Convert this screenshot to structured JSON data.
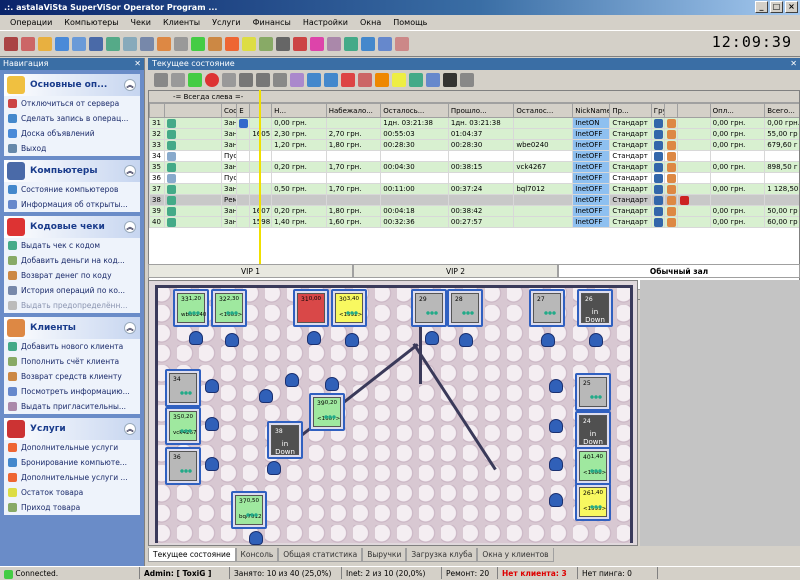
{
  "window": {
    "title": ".:. astalaViSta SuperViSor Operator Program ..."
  },
  "menu": [
    "Операции",
    "Компьютеры",
    "Чеки",
    "Клиенты",
    "Услуги",
    "Финансы",
    "Настройки",
    "Окна",
    "Помощь"
  ],
  "clock": "12:09:39",
  "nav": {
    "title": "Навигация",
    "sections": [
      {
        "title": "Основные оп...",
        "items": [
          "Отключиться от сервера",
          "Сделать запись в операц...",
          "Доска объявлений",
          "Выход"
        ]
      },
      {
        "title": "Компьютеры",
        "items": [
          "Состояние компьютеров",
          "Информация об открыты..."
        ]
      },
      {
        "title": "Кодовые чеки",
        "items": [
          "Выдать чек с кодом",
          "Добавить деньги на код...",
          "Возврат денег по коду",
          "История операций по ко...",
          "Выдать предопределённ..."
        ]
      },
      {
        "title": "Клиенты",
        "items": [
          "Добавить нового клиента",
          "Пополнить счёт клиента",
          "Возврат средств клиенту",
          "Посмотреть информацию...",
          "Выдать пригласительны..."
        ]
      },
      {
        "title": "Услуги",
        "items": [
          "Дополнительные услуги",
          "Бронирование компьюте...",
          "Дополнительные услуги ...",
          "Остаток товара",
          "Приход товара"
        ]
      }
    ]
  },
  "panel": {
    "title": "Текущее состояние",
    "group_header": "-= Всегда слева =-"
  },
  "table": {
    "columns": [
      "",
      "Состоя...",
      "Е",
      "Н...",
      "Набежало...",
      "Осталось...",
      "Прошло...",
      "Осталос...",
      "NickName",
      "Пр...",
      "Груп...",
      "",
      "",
      "",
      "Опл...",
      "Всего..."
    ],
    "rows": [
      {
        "num": "31",
        "state": "Занято",
        "n": "",
        "ran": "0,00 грн.",
        "left": "",
        "passed": "1дн. 03:21:38",
        "remain": "1дн. 03:21:38",
        "nick": "",
        "pr": "InetON",
        "group": "Стандарт",
        "paid": "0,00 грн.",
        "total": "0,00 грн."
      },
      {
        "num": "32",
        "state": "Занято",
        "n": "1605",
        "ran": "2,30 грн.",
        "left": "2,70 грн.",
        "passed": "00:55:03",
        "remain": "01:04:37",
        "nick": "",
        "pr": "InetOFF",
        "group": "Стандарт",
        "paid": "0,00 грн.",
        "total": "55,00 гр"
      },
      {
        "num": "33",
        "state": "Занято",
        "n": "",
        "ran": "1,20 грн.",
        "left": "1,80 грн.",
        "passed": "00:28:30",
        "remain": "00:28:30",
        "nick": "wbe0240",
        "pr": "InetOFF",
        "group": "Стандарт",
        "paid": "0,00 грн.",
        "total": "679,60 г"
      },
      {
        "num": "34",
        "state": "Пусто",
        "n": "",
        "ran": "",
        "left": "",
        "passed": "",
        "remain": "",
        "nick": "",
        "pr": "InetOFF",
        "group": "Стандарт",
        "paid": "",
        "total": ""
      },
      {
        "num": "35",
        "state": "Занято",
        "n": "",
        "ran": "0,20 грн.",
        "left": "1,70 грн.",
        "passed": "00:04:30",
        "remain": "00:38:15",
        "nick": "vck4267",
        "pr": "InetOFF",
        "group": "Стандарт",
        "paid": "0,00 грн.",
        "total": "898,50 г"
      },
      {
        "num": "36",
        "state": "Пусто",
        "n": "",
        "ran": "",
        "left": "",
        "passed": "",
        "remain": "",
        "nick": "",
        "pr": "InetOFF",
        "group": "Стандарт",
        "paid": "",
        "total": ""
      },
      {
        "num": "37",
        "state": "Занято",
        "n": "",
        "ran": "0,50 грн.",
        "left": "1,70 грн.",
        "passed": "00:11:00",
        "remain": "00:37:24",
        "nick": "bql7012",
        "pr": "InetOFF",
        "group": "Стандарт",
        "paid": "0,00 грн.",
        "total": "1 128,50"
      },
      {
        "num": "38",
        "state": "Ремонт",
        "n": "",
        "ran": "",
        "left": "",
        "passed": "",
        "remain": "",
        "nick": "",
        "pr": "InetOFF",
        "group": "Стандарт",
        "paid": "",
        "total": ""
      },
      {
        "num": "39",
        "state": "Занято",
        "n": "1607",
        "ran": "0,20 грн.",
        "left": "1,80 грн.",
        "passed": "00:04:18",
        "remain": "00:38:42",
        "nick": "",
        "pr": "InetOFF",
        "group": "Стандарт",
        "paid": "0,00 грн.",
        "total": "50,00 гр"
      },
      {
        "num": "40",
        "state": "Занято",
        "n": "1598",
        "ran": "1,40 грн.",
        "left": "1,60 грн.",
        "passed": "00:32:36",
        "remain": "00:27:57",
        "nick": "",
        "pr": "InetOFF",
        "group": "Стандарт",
        "paid": "0,00 грн.",
        "total": "60,00 гр"
      }
    ]
  },
  "hall_tabs": [
    "VIP 1",
    "VIP 2",
    "Обычный зал"
  ],
  "pcs": [
    {
      "num": "33",
      "amt": "1,20",
      "nick": "wbe0240",
      "color": "g1"
    },
    {
      "num": "32",
      "amt": "2,30",
      "nick": "<1605>",
      "color": "g1"
    },
    {
      "num": "31",
      "amt": "0,00",
      "nick": "",
      "color": "r1"
    },
    {
      "num": "30",
      "amt": "3,40",
      "nick": "<1592>",
      "color": "y1"
    },
    {
      "num": "29",
      "amt": "",
      "nick": "",
      "color": "gr1"
    },
    {
      "num": "28",
      "amt": "",
      "nick": "",
      "color": "gr1"
    },
    {
      "num": "27",
      "amt": "",
      "nick": "",
      "color": "gr1"
    },
    {
      "num": "26",
      "amt": "",
      "nick": "in Down",
      "color": "dk"
    },
    {
      "num": "34",
      "amt": "",
      "nick": "",
      "color": "gr1"
    },
    {
      "num": "35",
      "amt": "0,20",
      "nick": "vck4267",
      "color": "g1"
    },
    {
      "num": "36",
      "amt": "",
      "nick": "",
      "color": "gr1"
    },
    {
      "num": "39",
      "amt": "0,20",
      "nick": "<1607>",
      "color": "g1"
    },
    {
      "num": "38",
      "amt": "",
      "nick": "in Down",
      "color": "dk"
    },
    {
      "num": "37",
      "amt": "0,50",
      "nick": "bql7012",
      "color": "g1"
    },
    {
      "num": "25",
      "amt": "",
      "nick": "",
      "color": "gr1"
    },
    {
      "num": "24",
      "amt": "",
      "nick": "in Down",
      "color": "dk"
    },
    {
      "num": "40",
      "amt": "1,40",
      "nick": "<1606>",
      "color": "g1"
    },
    {
      "num": "26",
      "amt": "1,40",
      "nick": "<1595>",
      "color": "y1"
    }
  ],
  "bottom_tabs": [
    "Текущее состояние",
    "Консоль",
    "Общая статистика",
    "Выручки",
    "Загрузка клуба",
    "Окна у клиентов"
  ],
  "status": {
    "connected": "Connected.",
    "admin": "Admin: [ ToxiG ]",
    "busy": "Занято: 10 из 40 (25,0%)",
    "inet": "Inet: 2 из 10 (20,0%)",
    "repair": "Ремонт: 20",
    "noclient": "Нет клиента: 3",
    "noping": "Нет пинга: 0"
  }
}
